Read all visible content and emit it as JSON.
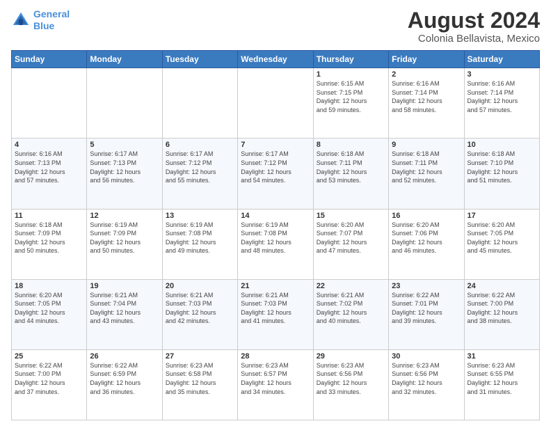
{
  "logo": {
    "line1": "General",
    "line2": "Blue"
  },
  "title": "August 2024",
  "subtitle": "Colonia Bellavista, Mexico",
  "days_of_week": [
    "Sunday",
    "Monday",
    "Tuesday",
    "Wednesday",
    "Thursday",
    "Friday",
    "Saturday"
  ],
  "weeks": [
    [
      {
        "day": "",
        "info": ""
      },
      {
        "day": "",
        "info": ""
      },
      {
        "day": "",
        "info": ""
      },
      {
        "day": "",
        "info": ""
      },
      {
        "day": "1",
        "info": "Sunrise: 6:15 AM\nSunset: 7:15 PM\nDaylight: 12 hours\nand 59 minutes."
      },
      {
        "day": "2",
        "info": "Sunrise: 6:16 AM\nSunset: 7:14 PM\nDaylight: 12 hours\nand 58 minutes."
      },
      {
        "day": "3",
        "info": "Sunrise: 6:16 AM\nSunset: 7:14 PM\nDaylight: 12 hours\nand 57 minutes."
      }
    ],
    [
      {
        "day": "4",
        "info": "Sunrise: 6:16 AM\nSunset: 7:13 PM\nDaylight: 12 hours\nand 57 minutes."
      },
      {
        "day": "5",
        "info": "Sunrise: 6:17 AM\nSunset: 7:13 PM\nDaylight: 12 hours\nand 56 minutes."
      },
      {
        "day": "6",
        "info": "Sunrise: 6:17 AM\nSunset: 7:12 PM\nDaylight: 12 hours\nand 55 minutes."
      },
      {
        "day": "7",
        "info": "Sunrise: 6:17 AM\nSunset: 7:12 PM\nDaylight: 12 hours\nand 54 minutes."
      },
      {
        "day": "8",
        "info": "Sunrise: 6:18 AM\nSunset: 7:11 PM\nDaylight: 12 hours\nand 53 minutes."
      },
      {
        "day": "9",
        "info": "Sunrise: 6:18 AM\nSunset: 7:11 PM\nDaylight: 12 hours\nand 52 minutes."
      },
      {
        "day": "10",
        "info": "Sunrise: 6:18 AM\nSunset: 7:10 PM\nDaylight: 12 hours\nand 51 minutes."
      }
    ],
    [
      {
        "day": "11",
        "info": "Sunrise: 6:18 AM\nSunset: 7:09 PM\nDaylight: 12 hours\nand 50 minutes."
      },
      {
        "day": "12",
        "info": "Sunrise: 6:19 AM\nSunset: 7:09 PM\nDaylight: 12 hours\nand 50 minutes."
      },
      {
        "day": "13",
        "info": "Sunrise: 6:19 AM\nSunset: 7:08 PM\nDaylight: 12 hours\nand 49 minutes."
      },
      {
        "day": "14",
        "info": "Sunrise: 6:19 AM\nSunset: 7:08 PM\nDaylight: 12 hours\nand 48 minutes."
      },
      {
        "day": "15",
        "info": "Sunrise: 6:20 AM\nSunset: 7:07 PM\nDaylight: 12 hours\nand 47 minutes."
      },
      {
        "day": "16",
        "info": "Sunrise: 6:20 AM\nSunset: 7:06 PM\nDaylight: 12 hours\nand 46 minutes."
      },
      {
        "day": "17",
        "info": "Sunrise: 6:20 AM\nSunset: 7:05 PM\nDaylight: 12 hours\nand 45 minutes."
      }
    ],
    [
      {
        "day": "18",
        "info": "Sunrise: 6:20 AM\nSunset: 7:05 PM\nDaylight: 12 hours\nand 44 minutes."
      },
      {
        "day": "19",
        "info": "Sunrise: 6:21 AM\nSunset: 7:04 PM\nDaylight: 12 hours\nand 43 minutes."
      },
      {
        "day": "20",
        "info": "Sunrise: 6:21 AM\nSunset: 7:03 PM\nDaylight: 12 hours\nand 42 minutes."
      },
      {
        "day": "21",
        "info": "Sunrise: 6:21 AM\nSunset: 7:03 PM\nDaylight: 12 hours\nand 41 minutes."
      },
      {
        "day": "22",
        "info": "Sunrise: 6:21 AM\nSunset: 7:02 PM\nDaylight: 12 hours\nand 40 minutes."
      },
      {
        "day": "23",
        "info": "Sunrise: 6:22 AM\nSunset: 7:01 PM\nDaylight: 12 hours\nand 39 minutes."
      },
      {
        "day": "24",
        "info": "Sunrise: 6:22 AM\nSunset: 7:00 PM\nDaylight: 12 hours\nand 38 minutes."
      }
    ],
    [
      {
        "day": "25",
        "info": "Sunrise: 6:22 AM\nSunset: 7:00 PM\nDaylight: 12 hours\nand 37 minutes."
      },
      {
        "day": "26",
        "info": "Sunrise: 6:22 AM\nSunset: 6:59 PM\nDaylight: 12 hours\nand 36 minutes."
      },
      {
        "day": "27",
        "info": "Sunrise: 6:23 AM\nSunset: 6:58 PM\nDaylight: 12 hours\nand 35 minutes."
      },
      {
        "day": "28",
        "info": "Sunrise: 6:23 AM\nSunset: 6:57 PM\nDaylight: 12 hours\nand 34 minutes."
      },
      {
        "day": "29",
        "info": "Sunrise: 6:23 AM\nSunset: 6:56 PM\nDaylight: 12 hours\nand 33 minutes."
      },
      {
        "day": "30",
        "info": "Sunrise: 6:23 AM\nSunset: 6:56 PM\nDaylight: 12 hours\nand 32 minutes."
      },
      {
        "day": "31",
        "info": "Sunrise: 6:23 AM\nSunset: 6:55 PM\nDaylight: 12 hours\nand 31 minutes."
      }
    ]
  ]
}
